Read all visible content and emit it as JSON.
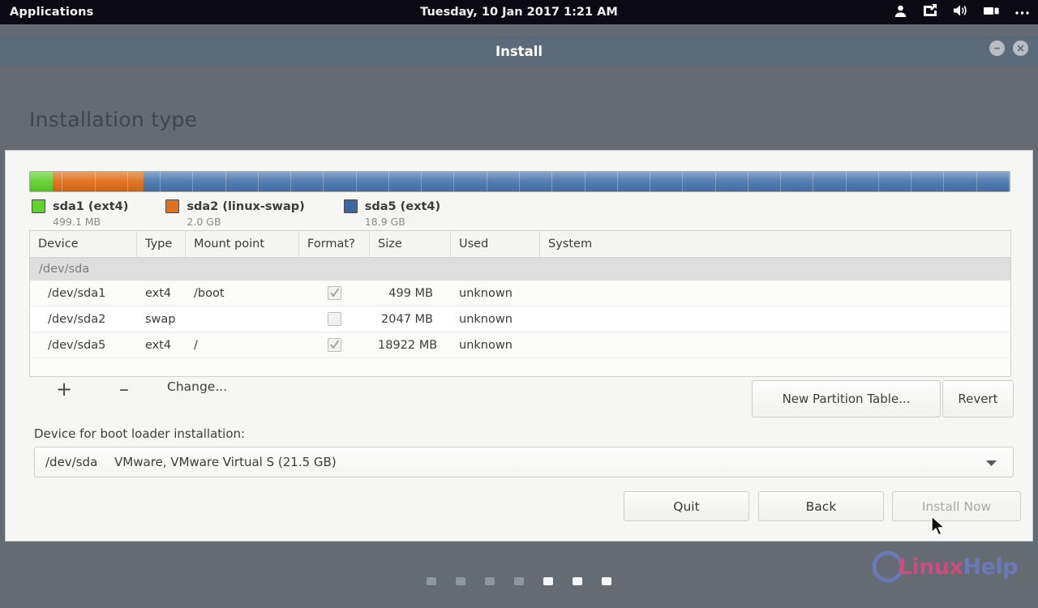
{
  "topbar": {
    "applications_label": "Applications",
    "clock": "Tuesday, 10 Jan 2017  1:21 AM",
    "tray_icons": [
      "user-icon",
      "network-icon",
      "volume-icon",
      "displays-icon",
      "overflow-menu-icon"
    ]
  },
  "window": {
    "title": "Install",
    "minimize_label": "–",
    "close_label": "✕"
  },
  "page": {
    "title": "Installation type"
  },
  "disk": {
    "segments": [
      {
        "label": "sda1 (ext4)",
        "size": "499.1 MB",
        "color": "#5fd42f",
        "percent": 2.3
      },
      {
        "label": "sda2 (linux-swap)",
        "size": "2.0 GB",
        "color": "#e0701a",
        "percent": 9.3
      },
      {
        "label": "sda5 (ext4)",
        "size": "18.9 GB",
        "color": "#4a78ad",
        "percent": 88.4
      }
    ]
  },
  "table": {
    "columns": [
      "Device",
      "Type",
      "Mount point",
      "Format?",
      "Size",
      "Used",
      "System"
    ],
    "group": "/dev/sda",
    "rows": [
      {
        "device": "/dev/sda1",
        "type": "ext4",
        "mount": "/boot",
        "format": true,
        "size": "499 MB",
        "used": "unknown",
        "system": ""
      },
      {
        "device": "/dev/sda2",
        "type": "swap",
        "mount": "",
        "format": false,
        "size": "2047 MB",
        "used": "unknown",
        "system": ""
      },
      {
        "device": "/dev/sda5",
        "type": "ext4",
        "mount": "/",
        "format": true,
        "size": "18922 MB",
        "used": "unknown",
        "system": ""
      }
    ]
  },
  "actions": {
    "add_label": "+",
    "remove_label": "–",
    "change_label": "Change...",
    "new_partition_table_label": "New Partition Table...",
    "revert_label": "Revert"
  },
  "bootloader": {
    "label": "Device for boot loader installation:",
    "selected_device": "/dev/sda",
    "selected_description": "VMware, VMware Virtual S (21.5 GB)"
  },
  "nav": {
    "quit_label": "Quit",
    "back_label": "Back",
    "install_label": "Install Now",
    "install_disabled": true
  },
  "footer": {
    "dots_total": 7,
    "dots_active_from": 4,
    "watermark_linux": "Linux",
    "watermark_help": "Help",
    "watermark_colors": {
      "linux": "#c94d7e",
      "help": "#6879b4"
    }
  }
}
